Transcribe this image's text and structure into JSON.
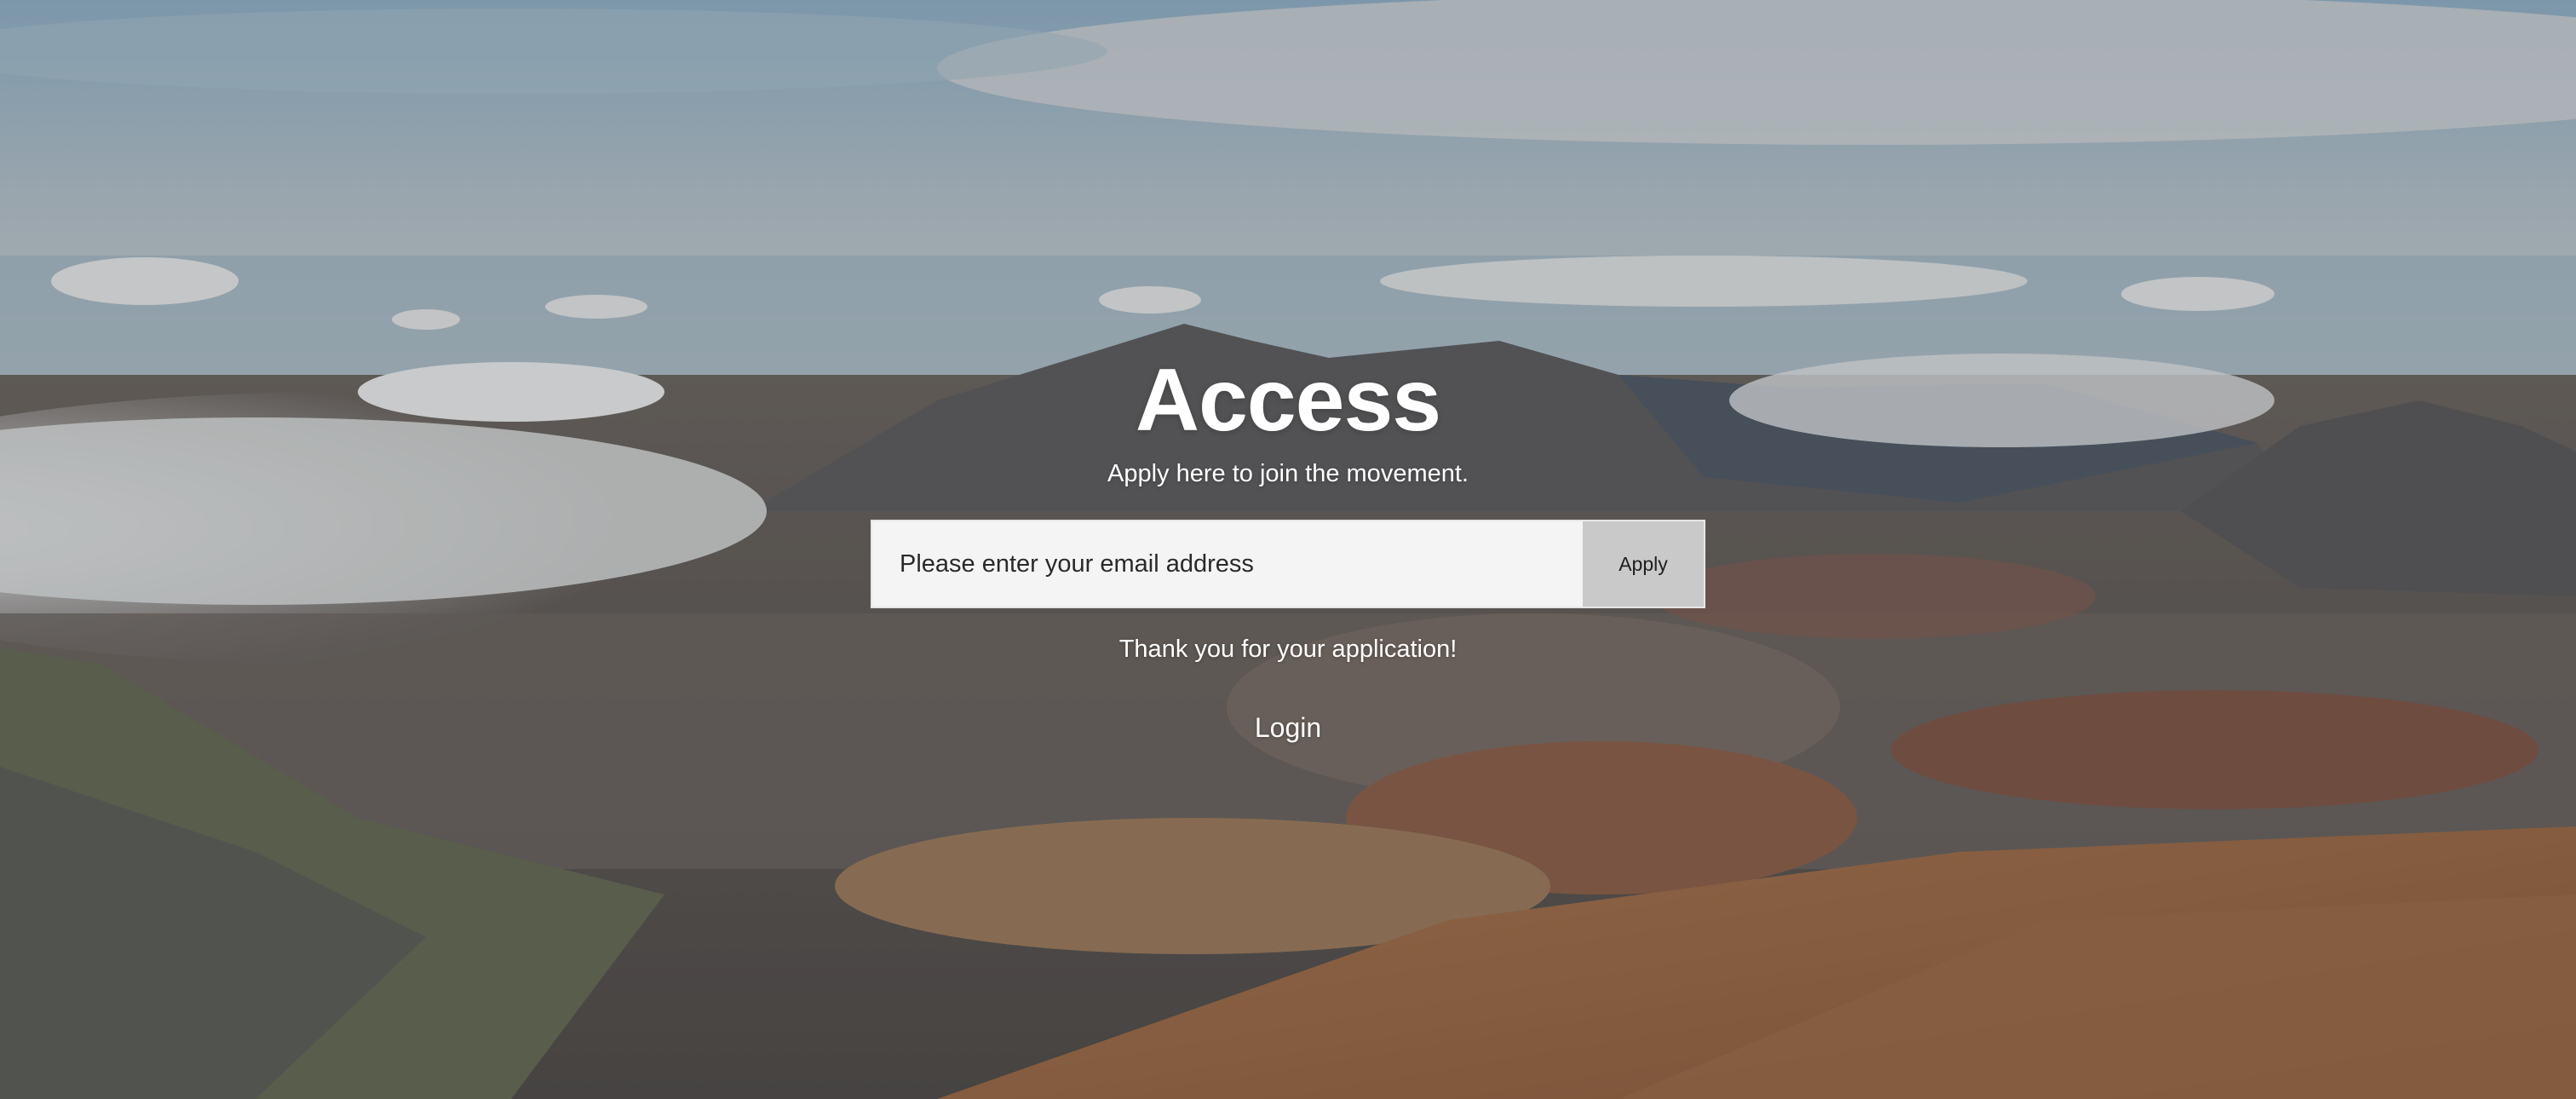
{
  "hero": {
    "title": "Access",
    "subtitle": "Apply here to join the movement."
  },
  "signup_form": {
    "email_placeholder": "Please enter your email address",
    "email_value": "",
    "apply_label": "Apply"
  },
  "status": {
    "message": "Thank you for your application!"
  },
  "nav": {
    "login_label": "Login"
  },
  "colors": {
    "text": "#ffffff",
    "input_bg": "#f4f4f4",
    "button_bg": "#c9c9c9"
  }
}
